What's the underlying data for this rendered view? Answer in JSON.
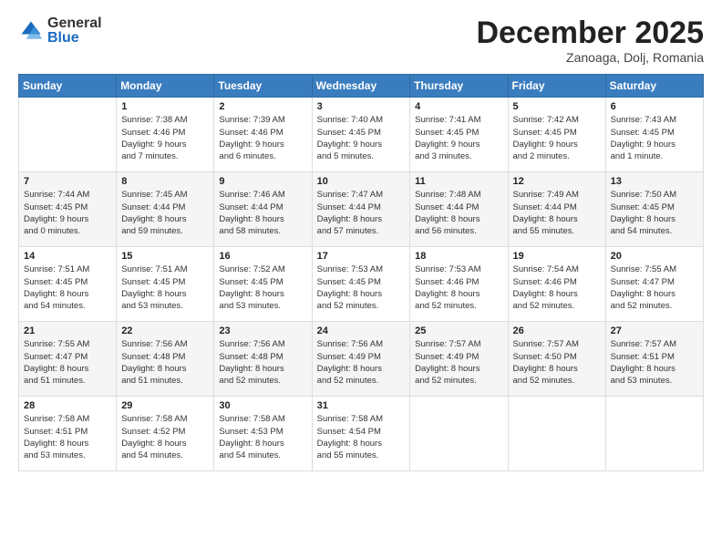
{
  "logo": {
    "general": "General",
    "blue": "Blue"
  },
  "header": {
    "month": "December 2025",
    "location": "Zanoaga, Dolj, Romania"
  },
  "weekdays": [
    "Sunday",
    "Monday",
    "Tuesday",
    "Wednesday",
    "Thursday",
    "Friday",
    "Saturday"
  ],
  "weeks": [
    [
      {
        "day": "",
        "info": ""
      },
      {
        "day": "1",
        "info": "Sunrise: 7:38 AM\nSunset: 4:46 PM\nDaylight: 9 hours\nand 7 minutes."
      },
      {
        "day": "2",
        "info": "Sunrise: 7:39 AM\nSunset: 4:46 PM\nDaylight: 9 hours\nand 6 minutes."
      },
      {
        "day": "3",
        "info": "Sunrise: 7:40 AM\nSunset: 4:45 PM\nDaylight: 9 hours\nand 5 minutes."
      },
      {
        "day": "4",
        "info": "Sunrise: 7:41 AM\nSunset: 4:45 PM\nDaylight: 9 hours\nand 3 minutes."
      },
      {
        "day": "5",
        "info": "Sunrise: 7:42 AM\nSunset: 4:45 PM\nDaylight: 9 hours\nand 2 minutes."
      },
      {
        "day": "6",
        "info": "Sunrise: 7:43 AM\nSunset: 4:45 PM\nDaylight: 9 hours\nand 1 minute."
      }
    ],
    [
      {
        "day": "7",
        "info": "Sunrise: 7:44 AM\nSunset: 4:45 PM\nDaylight: 9 hours\nand 0 minutes."
      },
      {
        "day": "8",
        "info": "Sunrise: 7:45 AM\nSunset: 4:44 PM\nDaylight: 8 hours\nand 59 minutes."
      },
      {
        "day": "9",
        "info": "Sunrise: 7:46 AM\nSunset: 4:44 PM\nDaylight: 8 hours\nand 58 minutes."
      },
      {
        "day": "10",
        "info": "Sunrise: 7:47 AM\nSunset: 4:44 PM\nDaylight: 8 hours\nand 57 minutes."
      },
      {
        "day": "11",
        "info": "Sunrise: 7:48 AM\nSunset: 4:44 PM\nDaylight: 8 hours\nand 56 minutes."
      },
      {
        "day": "12",
        "info": "Sunrise: 7:49 AM\nSunset: 4:44 PM\nDaylight: 8 hours\nand 55 minutes."
      },
      {
        "day": "13",
        "info": "Sunrise: 7:50 AM\nSunset: 4:45 PM\nDaylight: 8 hours\nand 54 minutes."
      }
    ],
    [
      {
        "day": "14",
        "info": "Sunrise: 7:51 AM\nSunset: 4:45 PM\nDaylight: 8 hours\nand 54 minutes."
      },
      {
        "day": "15",
        "info": "Sunrise: 7:51 AM\nSunset: 4:45 PM\nDaylight: 8 hours\nand 53 minutes."
      },
      {
        "day": "16",
        "info": "Sunrise: 7:52 AM\nSunset: 4:45 PM\nDaylight: 8 hours\nand 53 minutes."
      },
      {
        "day": "17",
        "info": "Sunrise: 7:53 AM\nSunset: 4:45 PM\nDaylight: 8 hours\nand 52 minutes."
      },
      {
        "day": "18",
        "info": "Sunrise: 7:53 AM\nSunset: 4:46 PM\nDaylight: 8 hours\nand 52 minutes."
      },
      {
        "day": "19",
        "info": "Sunrise: 7:54 AM\nSunset: 4:46 PM\nDaylight: 8 hours\nand 52 minutes."
      },
      {
        "day": "20",
        "info": "Sunrise: 7:55 AM\nSunset: 4:47 PM\nDaylight: 8 hours\nand 52 minutes."
      }
    ],
    [
      {
        "day": "21",
        "info": "Sunrise: 7:55 AM\nSunset: 4:47 PM\nDaylight: 8 hours\nand 51 minutes."
      },
      {
        "day": "22",
        "info": "Sunrise: 7:56 AM\nSunset: 4:48 PM\nDaylight: 8 hours\nand 51 minutes."
      },
      {
        "day": "23",
        "info": "Sunrise: 7:56 AM\nSunset: 4:48 PM\nDaylight: 8 hours\nand 52 minutes."
      },
      {
        "day": "24",
        "info": "Sunrise: 7:56 AM\nSunset: 4:49 PM\nDaylight: 8 hours\nand 52 minutes."
      },
      {
        "day": "25",
        "info": "Sunrise: 7:57 AM\nSunset: 4:49 PM\nDaylight: 8 hours\nand 52 minutes."
      },
      {
        "day": "26",
        "info": "Sunrise: 7:57 AM\nSunset: 4:50 PM\nDaylight: 8 hours\nand 52 minutes."
      },
      {
        "day": "27",
        "info": "Sunrise: 7:57 AM\nSunset: 4:51 PM\nDaylight: 8 hours\nand 53 minutes."
      }
    ],
    [
      {
        "day": "28",
        "info": "Sunrise: 7:58 AM\nSunset: 4:51 PM\nDaylight: 8 hours\nand 53 minutes."
      },
      {
        "day": "29",
        "info": "Sunrise: 7:58 AM\nSunset: 4:52 PM\nDaylight: 8 hours\nand 54 minutes."
      },
      {
        "day": "30",
        "info": "Sunrise: 7:58 AM\nSunset: 4:53 PM\nDaylight: 8 hours\nand 54 minutes."
      },
      {
        "day": "31",
        "info": "Sunrise: 7:58 AM\nSunset: 4:54 PM\nDaylight: 8 hours\nand 55 minutes."
      },
      {
        "day": "",
        "info": ""
      },
      {
        "day": "",
        "info": ""
      },
      {
        "day": "",
        "info": ""
      }
    ]
  ]
}
